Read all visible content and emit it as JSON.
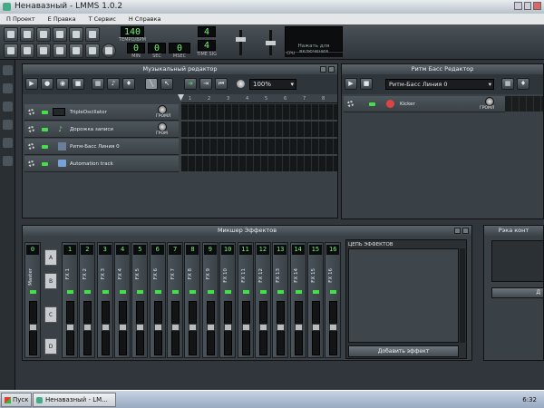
{
  "window": {
    "title": "Ненавазный - LMMS 1.0.2"
  },
  "menu": [
    "П Проект",
    "Е Правка",
    "Т Сервис",
    "Н Справка"
  ],
  "toolbar": {
    "tempo": {
      "value": "140",
      "label": "TEMPO/BPM"
    },
    "time": {
      "min": "0",
      "sec": "0",
      "msec": "0",
      "min_label": "MIN",
      "sec_label": "SEC",
      "msec_label": "MSEC"
    },
    "timesig": {
      "num": "4",
      "den": "4",
      "label": "TIME SIG"
    },
    "cpu": {
      "hint": "Нажать для включения",
      "label": "CPU"
    }
  },
  "song_editor": {
    "title": "Музыкальный редактор",
    "zoom": "100%",
    "tracks": [
      {
        "name": "TripleOscillator",
        "knob_label": "ГРОМЛ"
      },
      {
        "name": "Дорожка записи",
        "knob_label": "ГРОМ"
      },
      {
        "name": "Ритм-Басс Линия 0",
        "knob_label": ""
      },
      {
        "name": "Automation track",
        "knob_label": ""
      }
    ],
    "ruler": [
      "1",
      "2",
      "3",
      "4",
      "5",
      "6",
      "7",
      "8"
    ]
  },
  "bb_editor": {
    "title": "Ритм Басс Редактор",
    "pattern": "Ритм-Басс Линия 0",
    "track": {
      "name": "Kicker",
      "knob_label": "ГРОМЛ"
    }
  },
  "fx_mixer": {
    "title": "Микшер Эффектов",
    "master": {
      "num": "0",
      "label": "Master"
    },
    "banks": [
      "A",
      "B",
      "C",
      "D"
    ],
    "channels": [
      {
        "num": "1",
        "label": "FX 1"
      },
      {
        "num": "2",
        "label": "FX 2"
      },
      {
        "num": "3",
        "label": "FX 3"
      },
      {
        "num": "4",
        "label": "FX 4"
      },
      {
        "num": "5",
        "label": "FX 5"
      },
      {
        "num": "6",
        "label": "FX 6"
      },
      {
        "num": "7",
        "label": "FX 7"
      },
      {
        "num": "8",
        "label": "FX 8"
      },
      {
        "num": "9",
        "label": "FX 9"
      },
      {
        "num": "10",
        "label": "FX 10"
      },
      {
        "num": "11",
        "label": "FX 11"
      },
      {
        "num": "12",
        "label": "FX 12"
      },
      {
        "num": "13",
        "label": "FX 13"
      },
      {
        "num": "14",
        "label": "FX 14"
      },
      {
        "num": "15",
        "label": "FX 15"
      },
      {
        "num": "16",
        "label": "FX 16"
      }
    ],
    "chain_title": "ЦЕПЬ ЭФФЕКТОВ",
    "add_effect": "Добавить эффект"
  },
  "rack": {
    "title": "Рэка конт",
    "button": "Д"
  },
  "taskbar": {
    "start": "Пуск",
    "task": "Ненавазный - LM...",
    "clock": "6:32"
  }
}
